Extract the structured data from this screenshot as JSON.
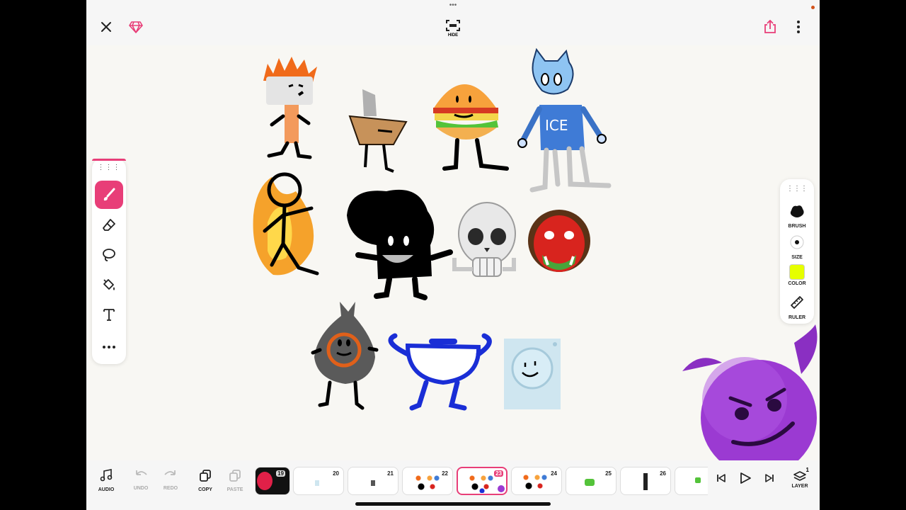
{
  "topbar": {
    "hide_label": "HIDE"
  },
  "left_tools": [
    "brush",
    "eraser",
    "lasso",
    "fill",
    "text",
    "more"
  ],
  "right_panel": {
    "brush_label": "BRUSH",
    "size_label": "SIZE",
    "color_label": "COLOR",
    "ruler_label": "RULER",
    "color_value": "#e6ff00"
  },
  "bottombar": {
    "audio_label": "AUDIO",
    "undo_label": "UNDO",
    "redo_label": "REDO",
    "copy_label": "COPY",
    "paste_label": "PASTE",
    "layer_label": "LAYER",
    "layer_count": "1",
    "frames": [
      "19",
      "20",
      "21",
      "22",
      "23",
      "24",
      "25",
      "26"
    ],
    "current_frame": "23"
  },
  "canvas": {
    "ice_text": "ICE"
  },
  "colors": {
    "accent": "#e83e78",
    "canvas": "#f8f7f3"
  }
}
